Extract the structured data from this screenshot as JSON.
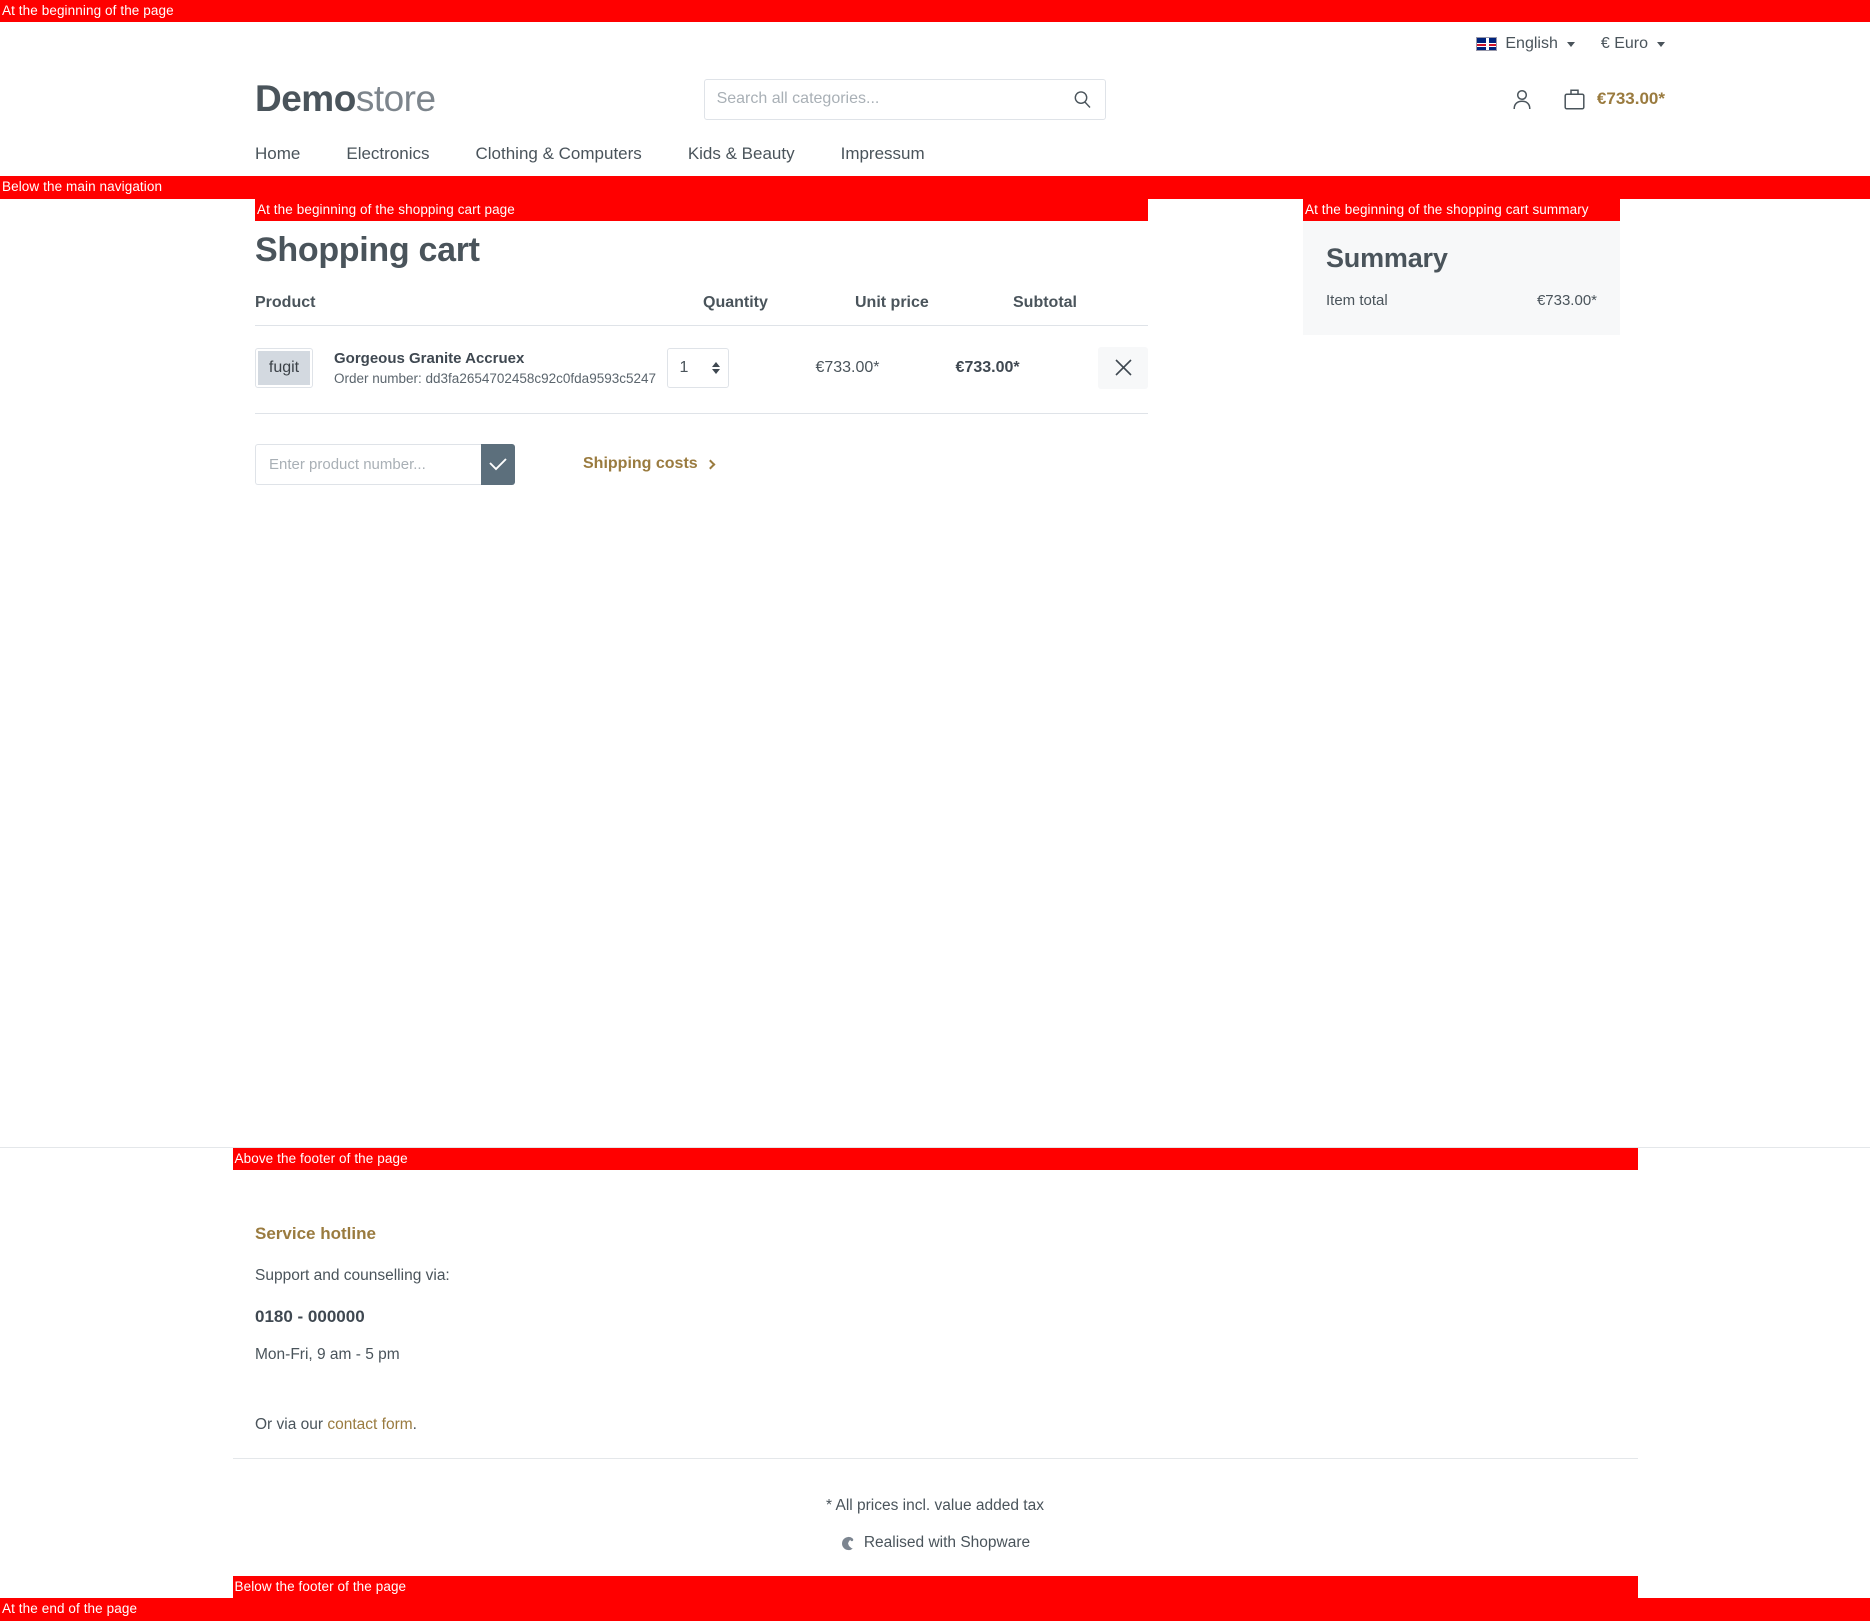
{
  "banners": {
    "page_start": "At the beginning of the page",
    "below_nav": "Below the main navigation",
    "cart_page_start": "At the beginning of the shopping cart page",
    "cart_summary_start": "At the beginning of the shopping cart summary",
    "above_footer": "Above the footer of the page",
    "below_footer": "Below the footer of the page",
    "page_end": "At the end of the page",
    "color": "#ff0000"
  },
  "topbar": {
    "language": "English",
    "currency": "€ Euro",
    "flag_icon": "uk-flag-icon"
  },
  "header": {
    "logo_bold": "Demo",
    "logo_light": "store",
    "search_placeholder": "Search all categories...",
    "search_value": "",
    "search_icon": "search-icon",
    "account_icon": "user-icon",
    "cart_icon": "shopping-bag-icon",
    "cart_total": "€733.00*"
  },
  "nav": {
    "items": [
      {
        "label": "Home"
      },
      {
        "label": "Electronics"
      },
      {
        "label": "Clothing & Computers"
      },
      {
        "label": "Kids & Beauty"
      },
      {
        "label": "Impressum"
      }
    ]
  },
  "cart": {
    "title": "Shopping cart",
    "columns": {
      "product": "Product",
      "quantity": "Quantity",
      "unit_price": "Unit price",
      "subtotal": "Subtotal"
    },
    "rows": [
      {
        "thumb_text": "fugit",
        "name": "Gorgeous Granite Accruex",
        "order_number_label": "Order number: dd3fa2654702458c92c0fda9593c5247",
        "quantity": "1",
        "unit_price": "€733.00*",
        "subtotal": "€733.00*",
        "remove_icon": "close-icon"
      }
    ],
    "product_number_placeholder": "Enter product number...",
    "product_number_value": "",
    "submit_icon": "check-icon",
    "shipping_costs_label": "Shipping costs",
    "shipping_chevron_icon": "chevron-right-icon"
  },
  "summary": {
    "title": "Summary",
    "rows": [
      {
        "label": "Item total",
        "value": "€733.00*"
      }
    ]
  },
  "footer": {
    "hotline_heading": "Service hotline",
    "support_text": "Support and counselling via:",
    "phone": "0180 - 000000",
    "hours": "Mon-Fri, 9 am - 5 pm",
    "contact_prefix": "Or via our ",
    "contact_link": "contact form",
    "contact_suffix": ".",
    "vat_note": "* All prices incl. value added tax",
    "realised_with": "Realised with Shopware",
    "shopware_icon": "shopware-logo-icon"
  },
  "colors": {
    "accent_gold": "#9a7b3f",
    "text": "#4a545b",
    "panel_bg": "#f7f8f9",
    "button_slate": "#5c6f7c"
  }
}
